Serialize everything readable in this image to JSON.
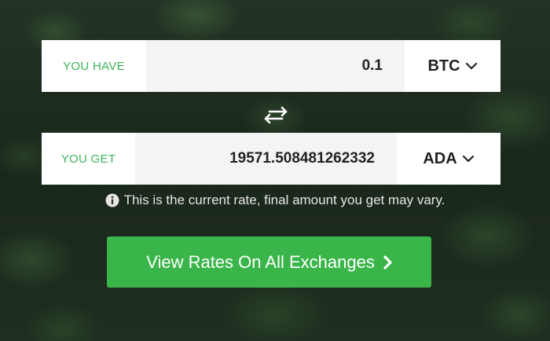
{
  "converter": {
    "have": {
      "label": "YOU HAVE",
      "amount": "0.1",
      "currency": "BTC"
    },
    "get": {
      "label": "YOU GET",
      "amount": "19571.508481262332",
      "currency": "ADA"
    },
    "swap_icon": "swap-arrows-icon",
    "note": "This is the current rate, final amount you get may vary.",
    "note_icon": "info-circle-icon",
    "cta_label": "View Rates On All Exchanges",
    "cta_icon": "chevron-right-icon"
  },
  "colors": {
    "accent": "#3ab54a",
    "label_green": "#3cb55a",
    "input_bg": "#f4f4f4"
  }
}
